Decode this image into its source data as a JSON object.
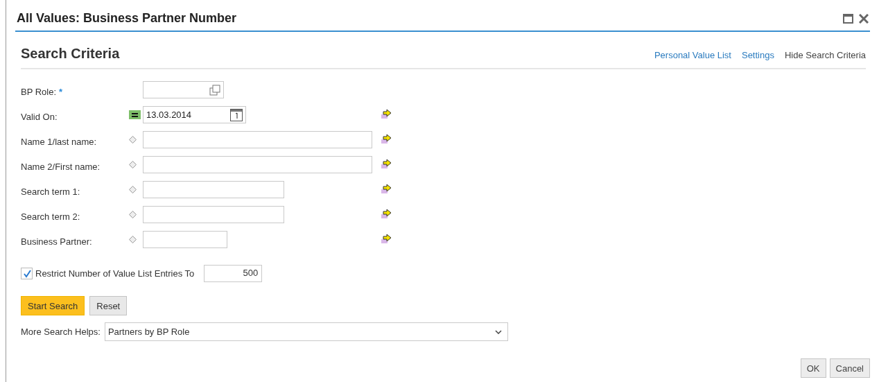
{
  "window": {
    "title": "All Values: Business Partner Number"
  },
  "section": {
    "title": "Search Criteria",
    "links": [
      {
        "label": "Personal Value List",
        "kind": "link"
      },
      {
        "label": "Settings",
        "kind": "link"
      },
      {
        "label": "Hide Search Criteria",
        "kind": "plain"
      }
    ]
  },
  "criteria": [
    {
      "label": "BP Role:",
      "required_mark": "*",
      "field": {
        "kind": "value-help"
      },
      "arrow": false
    },
    {
      "label": "Valid On:",
      "operator": {
        "kind": "equals"
      },
      "field": {
        "kind": "date",
        "value": "13.03.2014"
      },
      "arrow": true
    },
    {
      "label": "Name 1/last name:",
      "operator": {
        "kind": "diamond"
      },
      "field": {
        "kind": "name"
      },
      "arrow": true
    },
    {
      "label": "Name 2/First name:",
      "operator": {
        "kind": "diamond"
      },
      "field": {
        "kind": "name"
      },
      "arrow": true
    },
    {
      "label": "Search term 1:",
      "operator": {
        "kind": "diamond"
      },
      "field": {
        "kind": "term"
      },
      "arrow": true
    },
    {
      "label": "Search term 2:",
      "operator": {
        "kind": "diamond"
      },
      "field": {
        "kind": "term"
      },
      "arrow": true
    },
    {
      "label": "Business Partner:",
      "operator": {
        "kind": "diamond"
      },
      "field": {
        "kind": "id"
      },
      "arrow": true
    }
  ],
  "restrict": {
    "checked": true,
    "label": "Restrict Number of Value List Entries To",
    "value": "500"
  },
  "buttons": [
    {
      "label": "Start Search",
      "kind": "primary"
    },
    {
      "label": "Reset",
      "kind": "secondary"
    }
  ],
  "more_search_helps": {
    "label": "More Search Helps:",
    "value": "Partners by BP Role"
  },
  "footer_buttons": [
    "OK",
    "Cancel"
  ]
}
